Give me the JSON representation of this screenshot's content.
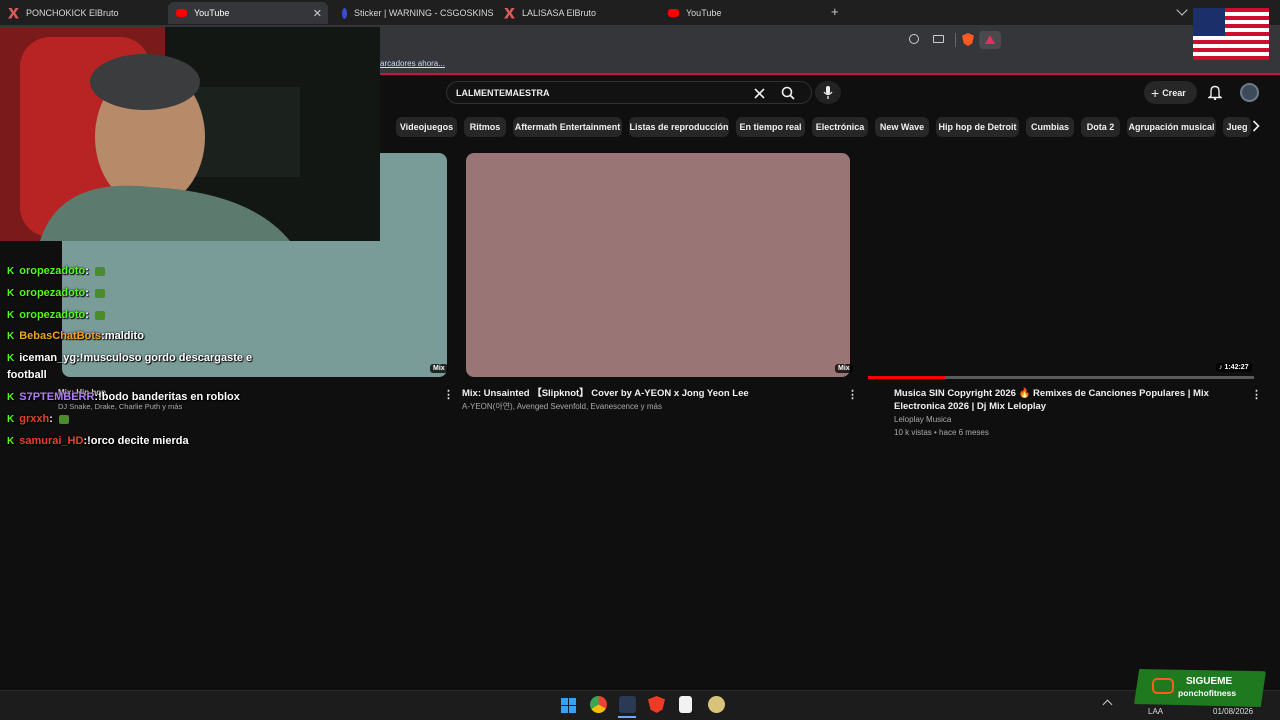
{
  "browser": {
    "tabs": [
      {
        "label": "PONCHOKICK ElBruto",
        "icon": "kick-x-icon"
      },
      {
        "label": "YouTube",
        "icon": "youtube-icon"
      },
      {
        "label": "Sticker | WARNING - CSGOSKINS.GG",
        "icon": "csgo-icon"
      },
      {
        "label": "LALISASA ElBruto",
        "icon": "kick-x-icon"
      },
      {
        "label": "YouTube",
        "icon": "youtube-icon"
      }
    ],
    "new_tab": "+",
    "close_glyph": "✕",
    "bookmarks_text": "arcadores ahora..."
  },
  "youtube": {
    "search_value": "LALMENTEMAESTRA",
    "create_label": "Crear",
    "chips": [
      "Videojuegos",
      "Ritmos",
      "Aftermath Entertainment",
      "Listas de reproducción",
      "En tiempo real",
      "Electrónica",
      "New Wave",
      "Hip hop de Detroit",
      "Cumbias",
      "Dota 2",
      "Agrupación musical",
      "Jueg"
    ],
    "videos": [
      {
        "badge": "Mix",
        "title": "Mix: Hip hop",
        "meta1": "DJ Snake, Drake, Charlie Puth y más",
        "meta2": ""
      },
      {
        "badge": "Mix",
        "title": "Mix: Unsainted 【Slipknot】 Cover by A-YEON x Jong Yeon Lee",
        "meta1": "A-YEON(아연), Avenged Sevenfold, Evanescence y más",
        "meta2": ""
      },
      {
        "badge": "1:42:27",
        "title_line1": "Musica SIN Copyright 2026 🔥 Remixes de Canciones Populares | Mix",
        "title_line2": "Electronica 2026 | Dj Mix Leloplay",
        "meta1": "Leloplay Musica",
        "meta2": "10 k vistas • hace 6 meses",
        "progress": 0.2
      }
    ],
    "colors": {
      "bg": "#0f0f0f",
      "chip": "#272727",
      "thumb2": "#997575",
      "thumb1": "#7a9c98",
      "progress": "#ff0000"
    }
  },
  "chat": [
    {
      "user": "oropezadoto",
      "sep": " :",
      "msg": "",
      "color": "#53fc18"
    },
    {
      "user": "oropezadoto",
      "sep": " :",
      "msg": "",
      "color": "#53fc18"
    },
    {
      "user": "oropezadoto",
      "sep": " :",
      "msg": "",
      "color": "#53fc18"
    },
    {
      "user": "BebasChatBots",
      "sep": " :",
      "msg": " maldito",
      "color": "#f2a12b"
    },
    {
      "user": "iceman_yg",
      "sep": " :",
      "msg": " !musculoso gordo descargaste e",
      "msg2": "football",
      "color": "#ffffff"
    },
    {
      "user": "S7PTEMBERR",
      "sep": " :",
      "msg": " !bodo banderitas en roblox",
      "color": "#b07ff5"
    },
    {
      "user": "grxxh",
      "sep": " :",
      "msg": "",
      "color": "#e8412e"
    },
    {
      "user": "samurai_HD",
      "sep": " :",
      "msg": " !orco decite mierda",
      "color": "#e8412e"
    }
  ],
  "overlay": {
    "follow_title": "SIGUEME",
    "follow_handle": "ponchofitness"
  },
  "taskbar": {
    "lang": "LAA",
    "date": "01/08/2026"
  }
}
